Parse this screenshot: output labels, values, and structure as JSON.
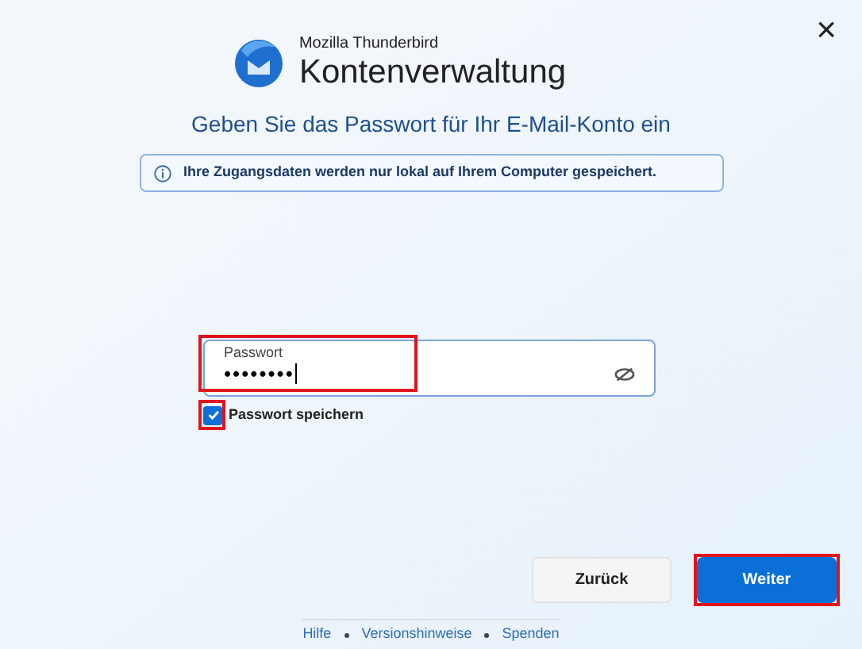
{
  "header": {
    "brand": "Mozilla Thunderbird",
    "title": "Kontenverwaltung"
  },
  "close": "×",
  "heading": "Geben Sie das Passwort für Ihr E-Mail-Konto ein",
  "info": "Ihre Zugangsdaten werden nur lokal auf Ihrem Computer gespeichert.",
  "password": {
    "label": "Passwort",
    "value": "••••••••",
    "highlighted": true
  },
  "remember": {
    "label": "Passwort speichern",
    "checked": true,
    "highlighted": true
  },
  "buttons": [
    {
      "label": "Zurück",
      "kind": "secondary",
      "highlighted": false
    },
    {
      "label": "Weiter",
      "kind": "primary",
      "highlighted": true
    }
  ],
  "footer": [
    "Hilfe",
    "Versionshinweise",
    "Spenden"
  ]
}
